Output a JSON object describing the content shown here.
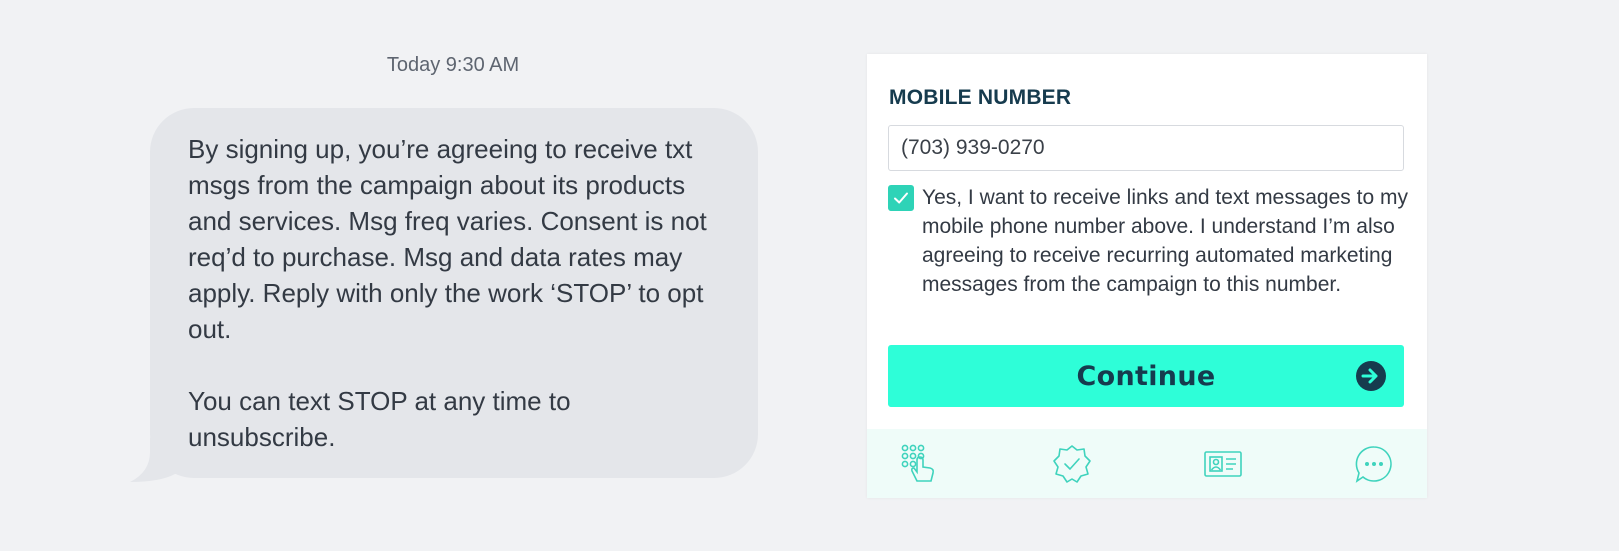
{
  "conversation": {
    "timestamp": "Today 9:30 AM",
    "message_paragraph_1": "By signing up, you’re agreeing to receive txt msgs from the campaign about its products and services. Msg freq varies. Consent is not req’d to purchase. Msg and data rates may apply. Reply with only the work ‘STOP’ to opt out.",
    "message_paragraph_2": "You can text STOP at any time to unsubscribe."
  },
  "form": {
    "mobile_label": "MOBILE NUMBER",
    "mobile_value": "(703) 939-0270",
    "consent_checked": true,
    "consent_text": "Yes, I want to receive links and text messages to my mobile phone number above. I understand I’m also agreeing to receive recurring automated marketing messages from the campaign to this number.",
    "continue_label": "Continue"
  },
  "footer_icons": [
    "keypad-tap-icon",
    "verified-badge-icon",
    "id-card-icon",
    "chat-bubble-icon"
  ],
  "colors": {
    "background": "#f1f2f4",
    "bubble": "#e4e6ea",
    "accent": "#2efed8",
    "checkbox": "#2ed3b7",
    "heading": "#163b4e",
    "icon_bar": "#effcf9",
    "icon_stroke": "#3fd3bd"
  }
}
